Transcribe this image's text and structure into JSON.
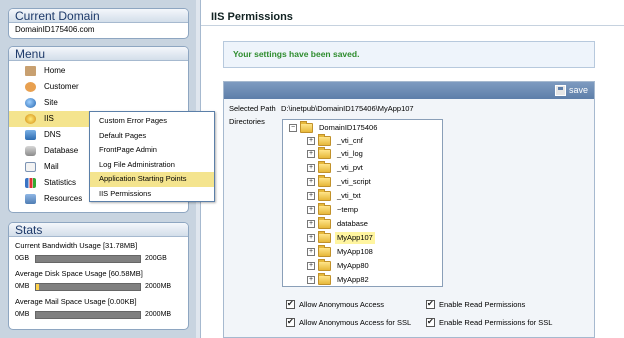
{
  "current_domain": {
    "title": "Current Domain",
    "value": "DomainID175406.com"
  },
  "menu": {
    "title": "Menu",
    "items": [
      {
        "label": "Home",
        "icon": "home-icon"
      },
      {
        "label": "Customer",
        "icon": "customer-icon"
      },
      {
        "label": "Site",
        "icon": "site-icon"
      },
      {
        "label": "IIS",
        "icon": "iis-icon"
      },
      {
        "label": "DNS",
        "icon": "dns-icon"
      },
      {
        "label": "Database",
        "icon": "database-icon"
      },
      {
        "label": "Mail",
        "icon": "mail-icon"
      },
      {
        "label": "Statistics",
        "icon": "statistics-icon"
      },
      {
        "label": "Resources",
        "icon": "resources-icon"
      }
    ],
    "active": "IIS",
    "submenu": [
      "Custom Error Pages",
      "Default Pages",
      "FrontPage Admin",
      "Log File Administration",
      "Application Starting Points",
      "IIS Permissions"
    ],
    "submenu_highlighted": "Application Starting Points"
  },
  "stats": {
    "title": "Stats",
    "items": [
      {
        "label": "Current Bandwidth Usage [31.78MB]",
        "min": "0GB",
        "max": "200GB",
        "fraction": 0.0002
      },
      {
        "label": "Average Disk Space Usage [60.58MB]",
        "min": "0MB",
        "max": "2000MB",
        "fraction": 0.03
      },
      {
        "label": "Average Mail Space Usage [0.00KB]",
        "min": "0MB",
        "max": "2000MB",
        "fraction": 0
      }
    ]
  },
  "page": {
    "title": "IIS Permissions",
    "success_message": "Your settings have been saved.",
    "save_label": "save",
    "selected_path_label": "Selected Path",
    "selected_path_value": "D:\\inetpub\\DomainID175406\\MyApp107",
    "directories_label": "Directories",
    "tree": {
      "root": "DomainID175406",
      "children": [
        "_vti_cnf",
        "_vti_log",
        "_vti_pvt",
        "_vti_script",
        "_vti_txt",
        "~temp",
        "database",
        "MyApp107",
        "MyApp108",
        "MyApp80",
        "MyApp82"
      ],
      "selected": "MyApp107"
    },
    "options": [
      {
        "label": "Allow Anonymous Access",
        "checked": true
      },
      {
        "label": "Enable Read Permissions",
        "checked": true
      },
      {
        "label": "Allow Anonymous Access for SSL",
        "checked": true
      },
      {
        "label": "Enable Read Permissions for SSL",
        "checked": true
      }
    ]
  },
  "colors": {
    "accent": "#5d7ea9",
    "success_text": "#2d8c2d",
    "highlight": "#f4e48e"
  }
}
